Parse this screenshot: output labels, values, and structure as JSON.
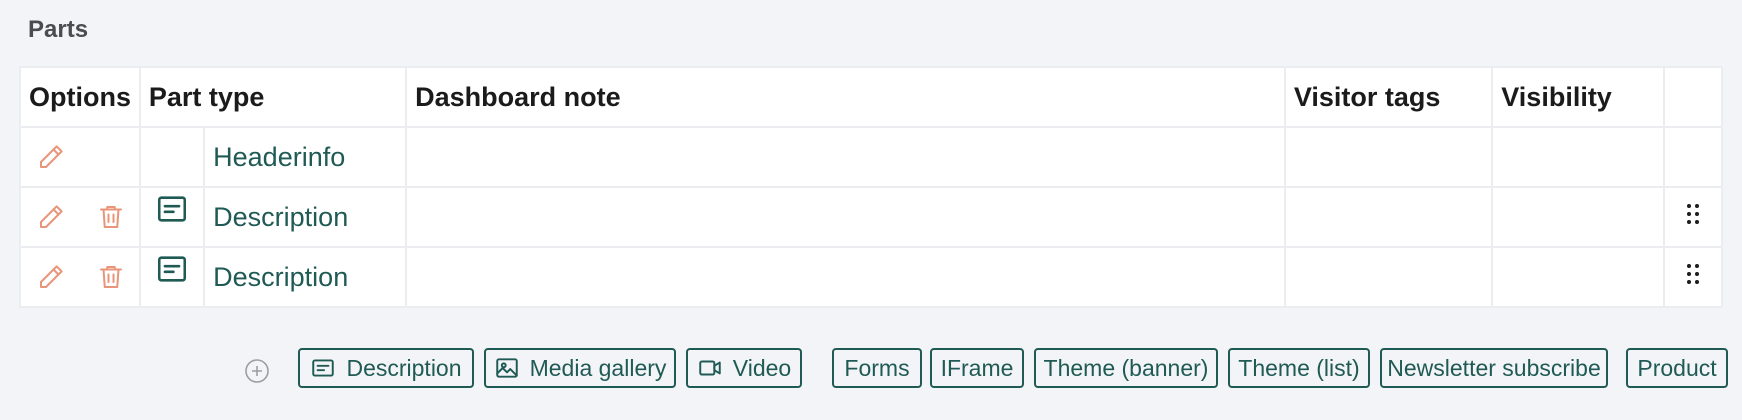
{
  "section_title": "Parts",
  "columns": {
    "options": "Options",
    "part_type": "Part type",
    "dashboard_note": "Dashboard note",
    "visitor_tags": "Visitor tags",
    "visibility": "Visibility"
  },
  "rows": [
    {
      "type_label": "Headerinfo",
      "deletable": false,
      "type_icon": "none",
      "draggable": false
    },
    {
      "type_label": "Description",
      "deletable": true,
      "type_icon": "text-block-icon",
      "draggable": true
    },
    {
      "type_label": "Description",
      "deletable": true,
      "type_icon": "text-block-icon",
      "draggable": true
    }
  ],
  "add_buttons": [
    {
      "label": "Description",
      "icon": "text-block-icon"
    },
    {
      "label": "Media gallery",
      "icon": "image-icon"
    },
    {
      "label": "Video",
      "icon": "video-icon"
    },
    {
      "label": "Forms"
    },
    {
      "label": "IFrame"
    },
    {
      "label": "Theme (banner)"
    },
    {
      "label": "Theme (list)"
    },
    {
      "label": "Newsletter subscribe"
    },
    {
      "label": "Product"
    }
  ],
  "colors": {
    "accent": "#1f5a54",
    "action": "#e8957a",
    "background": "#f3f4f7",
    "border": "#ebedf0"
  }
}
